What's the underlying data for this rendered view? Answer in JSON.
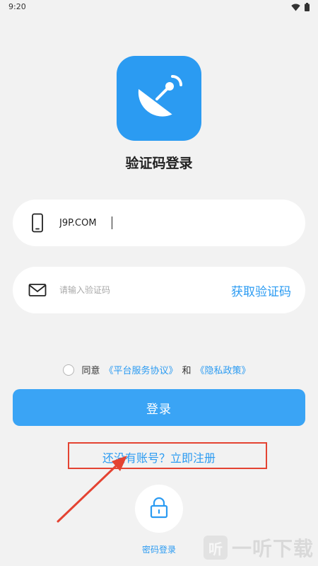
{
  "status_bar": {
    "time": "9:20",
    "icons": [
      "wifi-icon",
      "battery-icon"
    ]
  },
  "app": {
    "logo_icon": "satellite-dish-icon",
    "accent_color": "#2b9bf2",
    "title": "验证码登录"
  },
  "phone_field": {
    "icon": "phone-icon",
    "value": "J9P.COM"
  },
  "code_field": {
    "icon": "mail-icon",
    "placeholder": "请输入验证码",
    "get_code_label": "获取验证码"
  },
  "agreement": {
    "checked": false,
    "prefix": "同意",
    "terms_link": "《平台服务协议》",
    "and": "和",
    "privacy_link": "《隐私政策》"
  },
  "login_button": {
    "label": "登录"
  },
  "register": {
    "label": "还没有账号？立即注册"
  },
  "password_login": {
    "icon": "lock-icon",
    "label": "密码登录"
  },
  "watermark": {
    "glyph": "听",
    "text": "一听下载"
  }
}
